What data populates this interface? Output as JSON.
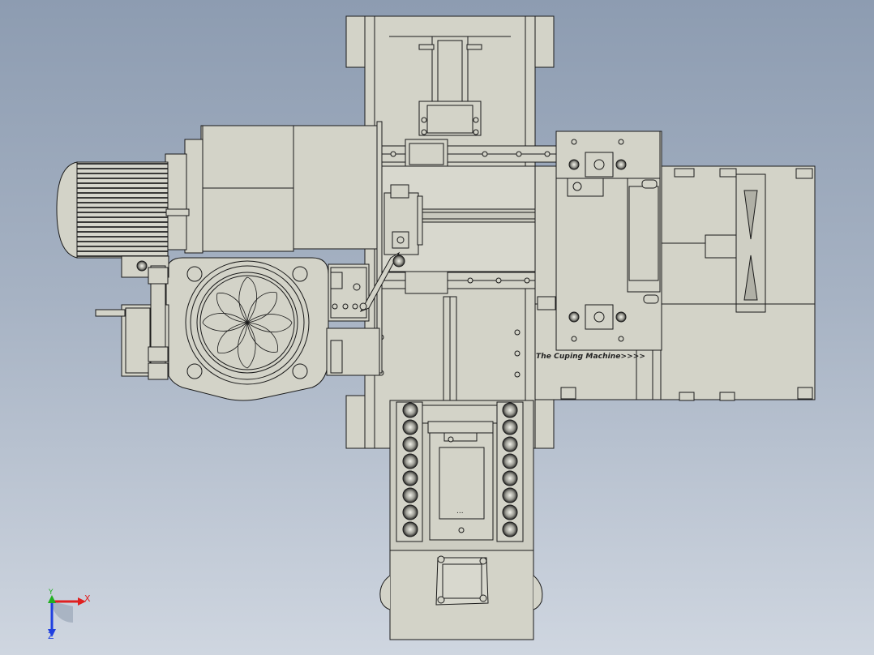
{
  "model": {
    "engraved_text": "The Cuping Machine>>>>"
  },
  "triad": {
    "x_label": "X",
    "y_label": "Y",
    "z_label": "Z",
    "x_color": "#e02020",
    "y_color": "#20b020",
    "z_color": "#2040e0"
  },
  "colors": {
    "background_top": "#8d9cb1",
    "background_bottom": "#cfd6e0",
    "part_fill": "#d3d3c8",
    "edge": "#1a1a1a"
  }
}
